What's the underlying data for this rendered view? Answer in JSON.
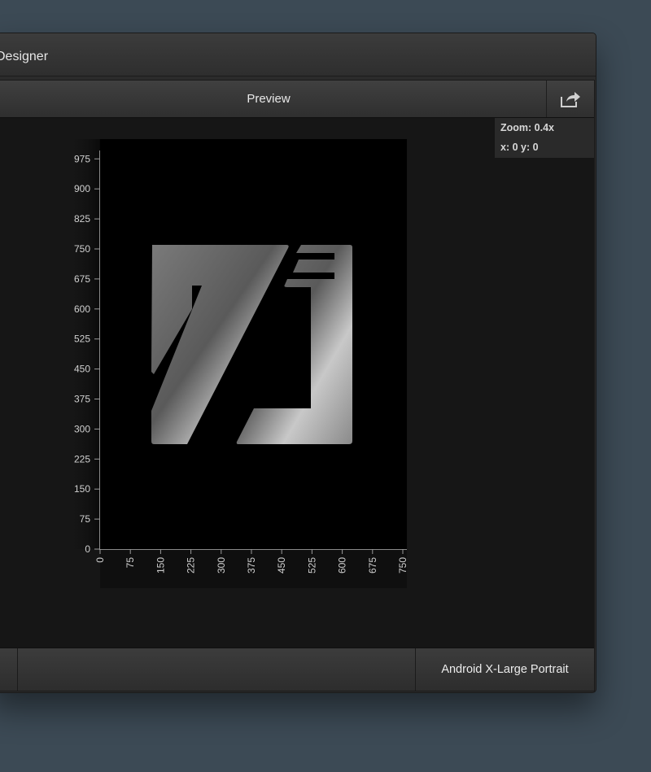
{
  "window": {
    "title": "Designer"
  },
  "toolbar": {
    "label": "Preview",
    "share_icon": "share-icon"
  },
  "info": {
    "zoom": "Zoom: 0.4x",
    "coords": "x: 0 y: 0"
  },
  "device": {
    "label": "Android X-Large Portrait"
  },
  "ruler": {
    "y_ticks": [
      "975",
      "900",
      "825",
      "750",
      "675",
      "600",
      "525",
      "450",
      "375",
      "300",
      "225",
      "150",
      "75",
      "0"
    ],
    "x_ticks": [
      "0",
      "75",
      "150",
      "225",
      "300",
      "375",
      "450",
      "525",
      "600",
      "675",
      "750"
    ]
  },
  "colors": {
    "background": "#3c4a55",
    "canvas": "#000000"
  }
}
